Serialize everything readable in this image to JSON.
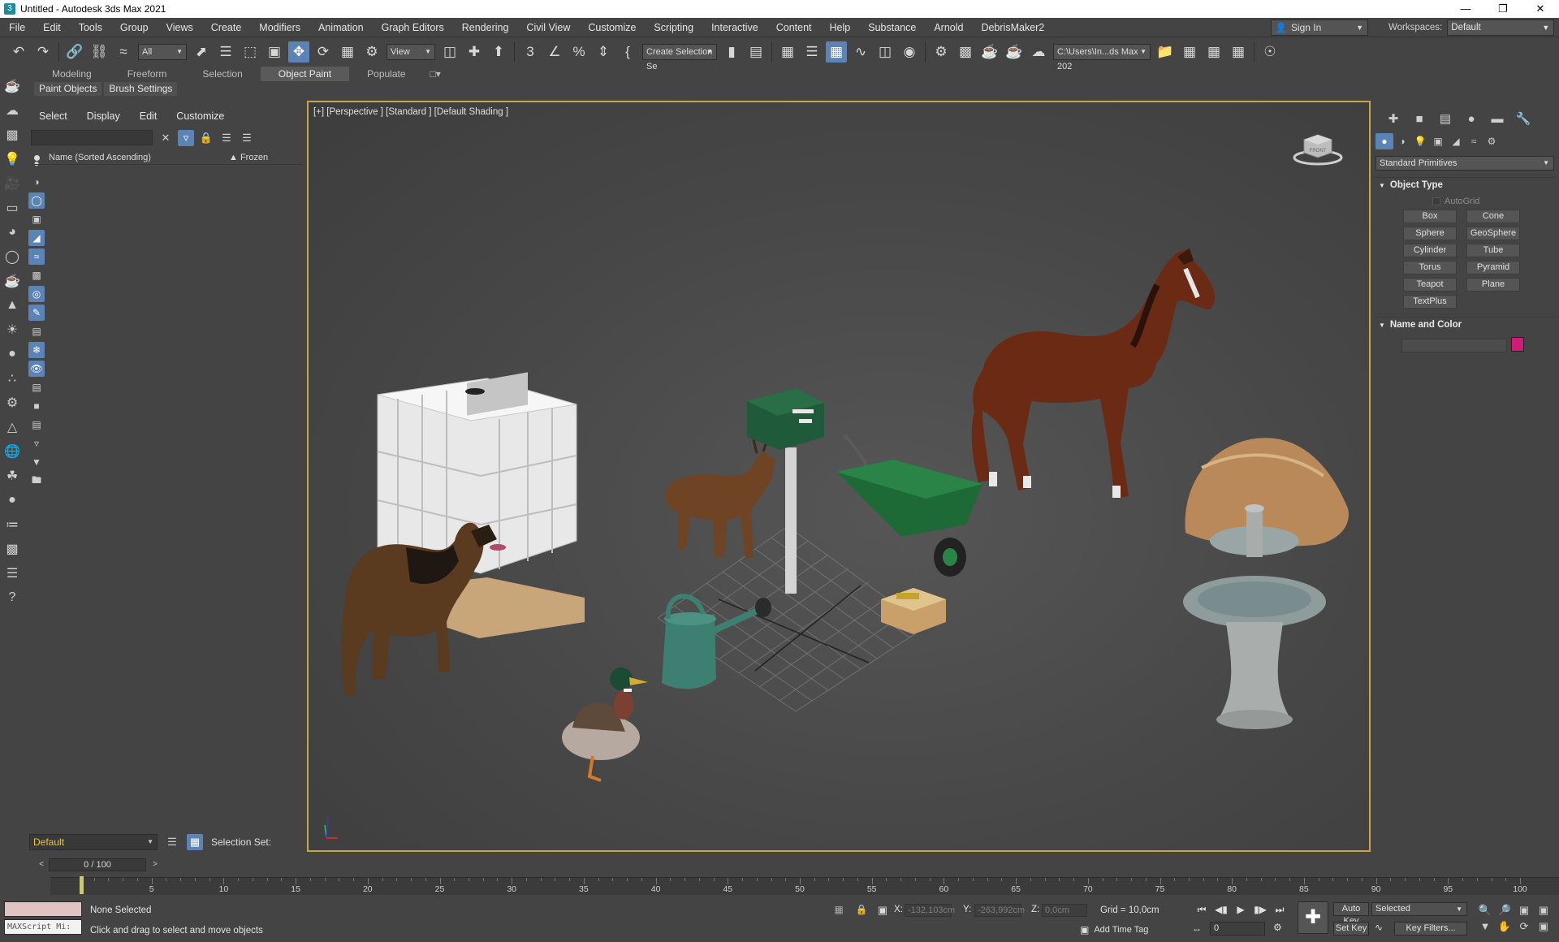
{
  "window": {
    "title": "Untitled - Autodesk 3ds Max 2021",
    "app_icon": "3ds-max-icon",
    "controls": [
      "minimize-icon",
      "restore-icon",
      "close-icon"
    ]
  },
  "menubar": {
    "items": [
      "File",
      "Edit",
      "Tools",
      "Group",
      "Views",
      "Create",
      "Modifiers",
      "Animation",
      "Graph Editors",
      "Rendering",
      "Civil View",
      "Customize",
      "Scripting",
      "Interactive",
      "Content",
      "Help",
      "Substance",
      "Arnold",
      "DebrisMaker2"
    ],
    "sign_in": "Sign In",
    "workspaces_label": "Workspaces:",
    "workspace_value": "Default"
  },
  "toolbar": {
    "filter_value": "All",
    "view_value": "View",
    "selection_set_value": "Create Selection Se",
    "path_value": "C:\\Users\\In...ds Max 202"
  },
  "ribbon": {
    "tabs": [
      "Modeling",
      "Freeform",
      "Selection",
      "Object Paint",
      "Populate"
    ],
    "active_tab": "Object Paint",
    "sub_tabs": [
      "Paint Objects",
      "Brush Settings"
    ]
  },
  "explorer": {
    "menu": [
      "Select",
      "Display",
      "Edit",
      "Customize"
    ],
    "search_value": "",
    "columns": {
      "name": "Name (Sorted Ascending)",
      "frozen": "▲ Frozen"
    }
  },
  "viewport": {
    "label": "[+] [Perspective ] [Standard ] [Default Shading ]",
    "viewcube_face": "FRONT"
  },
  "command_panel": {
    "category": "Standard Primitives",
    "object_type_header": "Object Type",
    "autogrid_label": "AutoGrid",
    "primitives": [
      "Box",
      "Cone",
      "Sphere",
      "GeoSphere",
      "Cylinder",
      "Tube",
      "Torus",
      "Pyramid",
      "Teapot",
      "Plane",
      "TextPlus"
    ],
    "name_color_header": "Name and Color",
    "name_value": "",
    "object_color": "#d01b78"
  },
  "layer": {
    "current": "Default",
    "selection_set_label": "Selection Set:"
  },
  "timeline": {
    "frame_display": "0 / 100",
    "ticks": [
      "0",
      "5",
      "10",
      "15",
      "20",
      "25",
      "30",
      "35",
      "40",
      "45",
      "50",
      "55",
      "60",
      "65",
      "70",
      "75",
      "80",
      "85",
      "90",
      "95",
      "100"
    ],
    "current_frame": "0"
  },
  "status": {
    "maxscript_placeholder": "MAXScript Mi:",
    "selection": "None Selected",
    "prompt": "Click and drag to select and move objects",
    "x_label": "X:",
    "x_value": "-132,103cm",
    "y_label": "Y:",
    "y_value": "-263,992cm",
    "z_label": "Z:",
    "z_value": "0,0cm",
    "grid": "Grid = 10,0cm",
    "add_time_tag": "Add Time Tag",
    "auto_key": "Auto Key",
    "set_key": "Set Key",
    "key_mode": "Selected",
    "key_filters": "Key Filters..."
  },
  "colors": {
    "accent_blue": "#5b83b5",
    "viewport_border": "#c9a642",
    "layer_text": "#e7c54a"
  }
}
